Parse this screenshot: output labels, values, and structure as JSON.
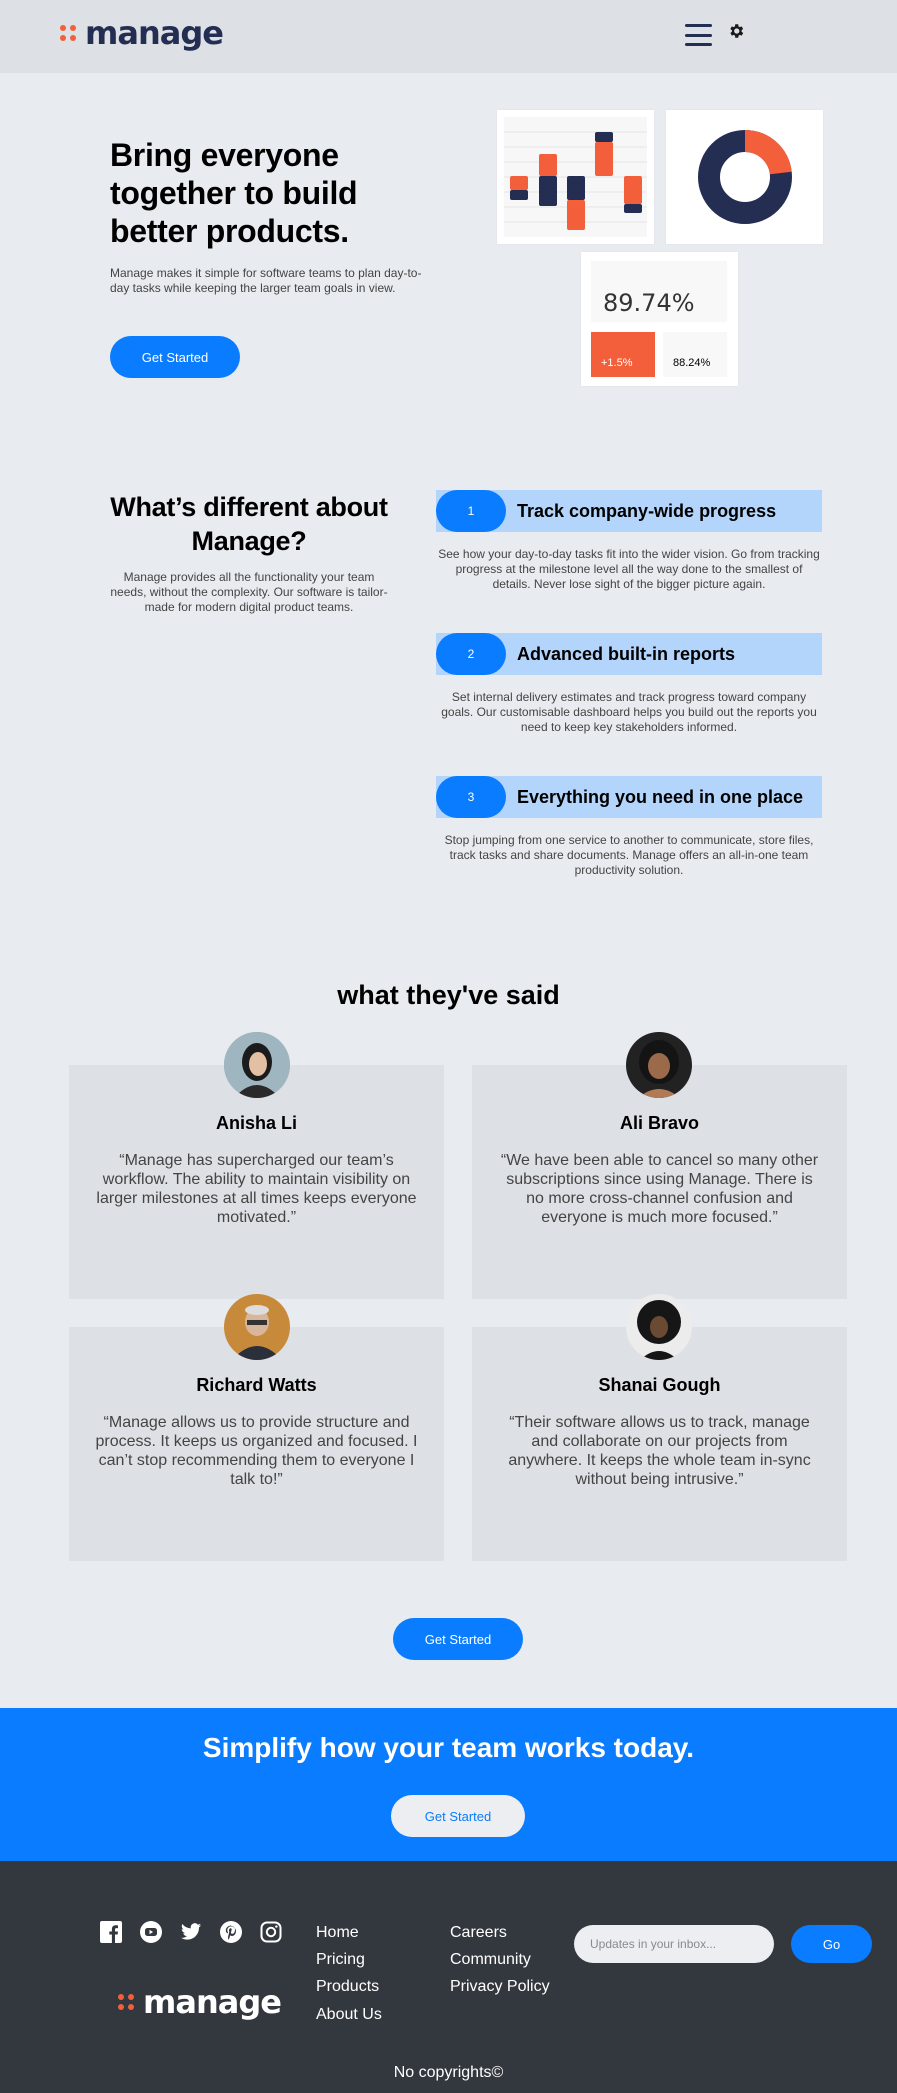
{
  "header": {
    "logo": "manage",
    "menu_icon": "hamburger-menu-icon",
    "settings_icon": "gear-icon"
  },
  "hero": {
    "title": "Bring everyone together to build better products.",
    "subtitle": "Manage makes it simple for software teams to plan day-to-day tasks while keeping the larger team goals in view.",
    "cta": "Get Started",
    "stat_value": "89.74%",
    "stat_change": "+1.5%",
    "stat_secondary": "88.24%"
  },
  "colors": {
    "accent": "#0a7cff",
    "orange": "#f25f3a",
    "navy": "#242d52",
    "feature_bar": "#b3d4fb",
    "footer": "#33373e"
  },
  "different": {
    "title": "What’s different about Manage?",
    "subtitle": "Manage provides all the functionality your team needs, without the complexity. Our software is tailor-made for modern digital product teams.",
    "features": [
      {
        "num": "1",
        "title": "Track company-wide progress",
        "desc": "See how your day-to-day tasks fit into the wider vision. Go from tracking progress at the milestone level all the way done to the smallest of details. Never lose sight of the bigger picture again."
      },
      {
        "num": "2",
        "title": "Advanced built-in reports",
        "desc": "Set internal delivery estimates and track progress toward company goals. Our customisable dashboard helps you build out the reports you need to keep key stakeholders informed."
      },
      {
        "num": "3",
        "title": "Everything you need in one place",
        "desc": "Stop jumping from one service to another to communicate, store files, track tasks and share documents. Manage offers an all-in-one team productivity solution."
      }
    ]
  },
  "testimonials": {
    "title": "what they've said",
    "items": [
      {
        "name": "Anisha Li",
        "quote": "“Manage has supercharged our team’s workflow. The ability to maintain visibility on larger milestones at all times keeps everyone motivated.”"
      },
      {
        "name": "Ali Bravo",
        "quote": "“We have been able to cancel so many other subscriptions since using Manage. There is no more cross-channel confusion and everyone is much more focused.”"
      },
      {
        "name": "Richard Watts",
        "quote": "“Manage allows us to provide structure and process. It keeps us organized and focused. I can’t stop recommending them to everyone I talk to!”"
      },
      {
        "name": "Shanai Gough",
        "quote": "“Their software allows us to track, manage and collaborate on our projects from anywhere. It keeps the whole team in-sync without being intrusive.”"
      }
    ],
    "cta": "Get Started"
  },
  "banner": {
    "title": "Simplify how your team works today.",
    "cta": "Get Started"
  },
  "footer": {
    "social": [
      "facebook-icon",
      "youtube-icon",
      "twitter-icon",
      "pinterest-icon",
      "instagram-icon"
    ],
    "logo": "manage",
    "links_col1": [
      "Home",
      "Pricing",
      "Products",
      "About Us"
    ],
    "links_col2": [
      "Careers",
      "Community",
      "Privacy Policy"
    ],
    "newsletter_placeholder": "Updates in your inbox...",
    "go_label": "Go",
    "copyright": "No copyrights©"
  }
}
